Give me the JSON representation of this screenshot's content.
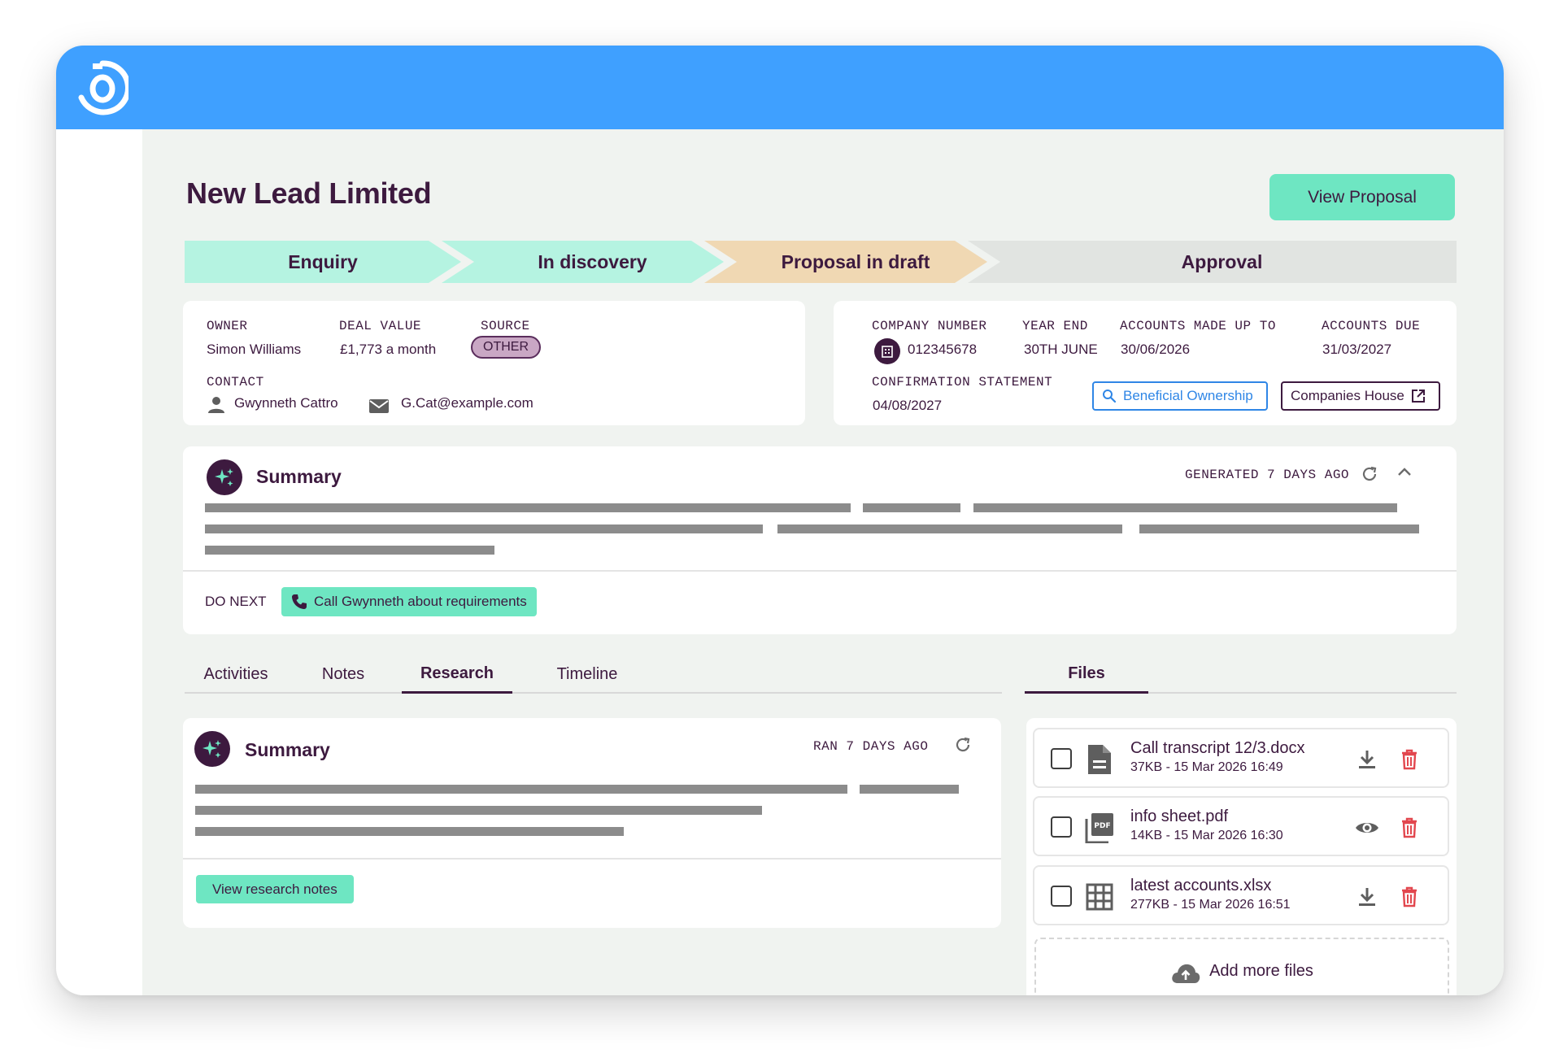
{
  "page": {
    "title": "New Lead Limited",
    "view_proposal_label": "View Proposal"
  },
  "pipeline": {
    "stages": [
      {
        "label": "Enquiry",
        "state": "complete",
        "color": "#b5f3e1"
      },
      {
        "label": "In discovery",
        "state": "complete",
        "color": "#b5f3e1"
      },
      {
        "label": "Proposal in draft",
        "state": "current",
        "color": "#f0d8b3"
      },
      {
        "label": "Approval",
        "state": "upcoming",
        "color": "#e1e4e1"
      }
    ]
  },
  "deal": {
    "owner_label": "OWNER",
    "owner": "Simon Williams",
    "deal_value_label": "DEAL VALUE",
    "deal_value": "£1,773 a month",
    "source_label": "SOURCE",
    "source": "OTHER",
    "contact_label": "CONTACT",
    "contact_name": "Gwynneth Cattro",
    "contact_email": "G.Cat@example.com"
  },
  "company": {
    "company_number_label": "COMPANY NUMBER",
    "company_number": "012345678",
    "year_end_label": "YEAR END",
    "year_end": "30TH JUNE",
    "accounts_made_up_to_label": "ACCOUNTS MADE UP TO",
    "accounts_made_up_to": "30/06/2026",
    "accounts_due_label": "ACCOUNTS DUE",
    "accounts_due": "31/03/2027",
    "confirmation_label": "CONFIRMATION STATEMENT",
    "confirmation": "04/08/2027",
    "beneficial_ownership_label": "Beneficial Ownership",
    "companies_house_label": "Companies House"
  },
  "summary": {
    "title": "Summary",
    "generated": "GENERATED 7 DAYS AGO",
    "do_next_label": "DO NEXT",
    "do_next_action": "Call Gwynneth about requirements"
  },
  "tabs": {
    "items": [
      "Activities",
      "Notes",
      "Research",
      "Timeline"
    ],
    "active": "Research"
  },
  "research": {
    "title": "Summary",
    "ran": "RAN 7 DAYS AGO",
    "view_notes_label": "View research notes"
  },
  "files": {
    "tab_label": "Files",
    "items": [
      {
        "name": "Call transcript 12/3.docx",
        "meta": "37KB - 15 Mar 2026 16:49",
        "icon": "document-icon",
        "action": "download-icon"
      },
      {
        "name": "info sheet.pdf",
        "meta": "14KB - 15 Mar 2026 16:30",
        "icon": "pdf-icon",
        "action": "eye-icon"
      },
      {
        "name": "latest accounts.xlsx",
        "meta": "277KB - 15 Mar 2026 16:51",
        "icon": "spreadsheet-icon",
        "action": "download-icon"
      }
    ],
    "add_label": "Add more files"
  },
  "colors": {
    "brand_blue": "#3fa0ff",
    "accent_mint": "#6ee6c2",
    "text_plum": "#3d1a3f",
    "delete_red": "#e2474e",
    "link_blue": "#2f86e6"
  }
}
